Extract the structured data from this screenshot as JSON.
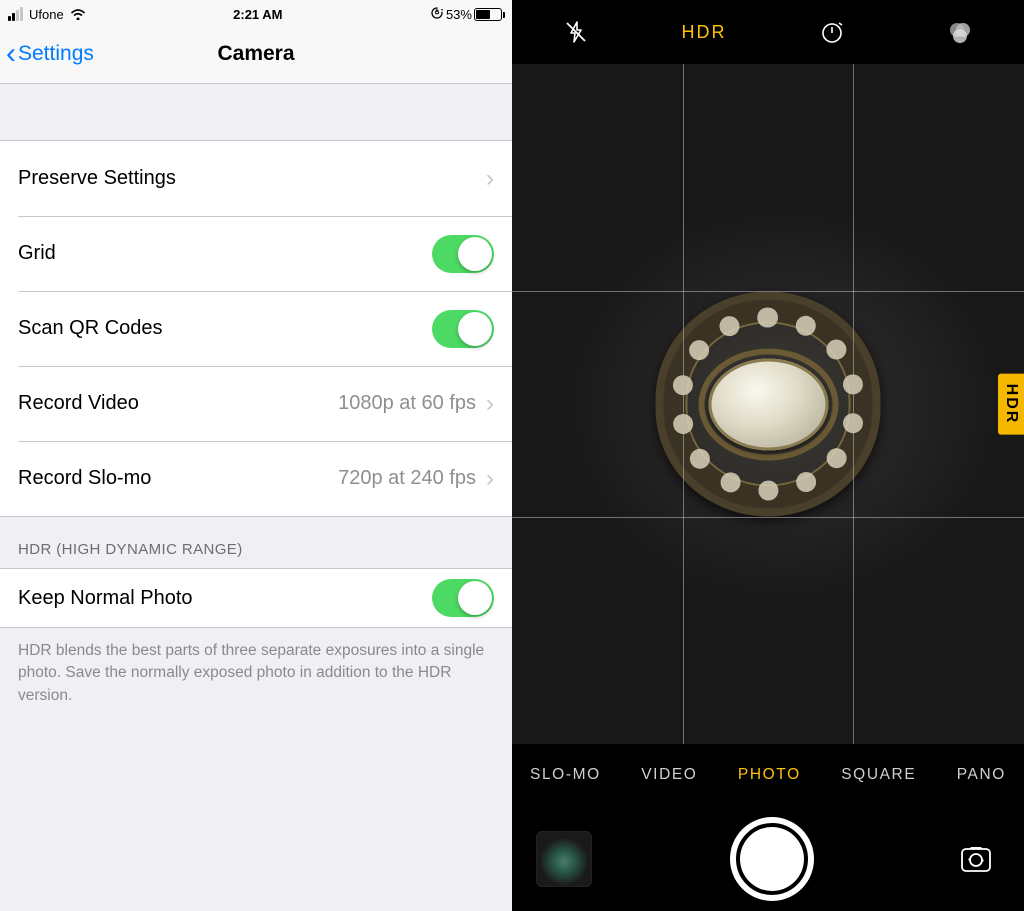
{
  "status": {
    "carrier": "Ufone",
    "time": "2:21 AM",
    "battery_pct": "53%",
    "battery_fill_pct": 53
  },
  "nav": {
    "back_label": "Settings",
    "title": "Camera"
  },
  "rows": {
    "preserve": "Preserve Settings",
    "grid": "Grid",
    "scan_qr": "Scan QR Codes",
    "record_video": "Record Video",
    "record_video_detail": "1080p at 60 fps",
    "record_slomo": "Record Slo-mo",
    "record_slomo_detail": "720p at 240 fps",
    "keep_normal": "Keep Normal Photo"
  },
  "toggles": {
    "grid": true,
    "scan_qr": true,
    "keep_normal": true
  },
  "section_hdr": "HDR (HIGH DYNAMIC RANGE)",
  "footer": "HDR blends the best parts of three separate exposures into a single photo. Save the normally exposed photo in addition to the HDR version.",
  "camera": {
    "hdr_label_top": "HDR",
    "hdr_badge": "HDR",
    "modes": {
      "slomo": "SLO-MO",
      "video": "VIDEO",
      "photo": "PHOTO",
      "square": "SQUARE",
      "pano": "PANO"
    },
    "active_mode": "photo"
  }
}
